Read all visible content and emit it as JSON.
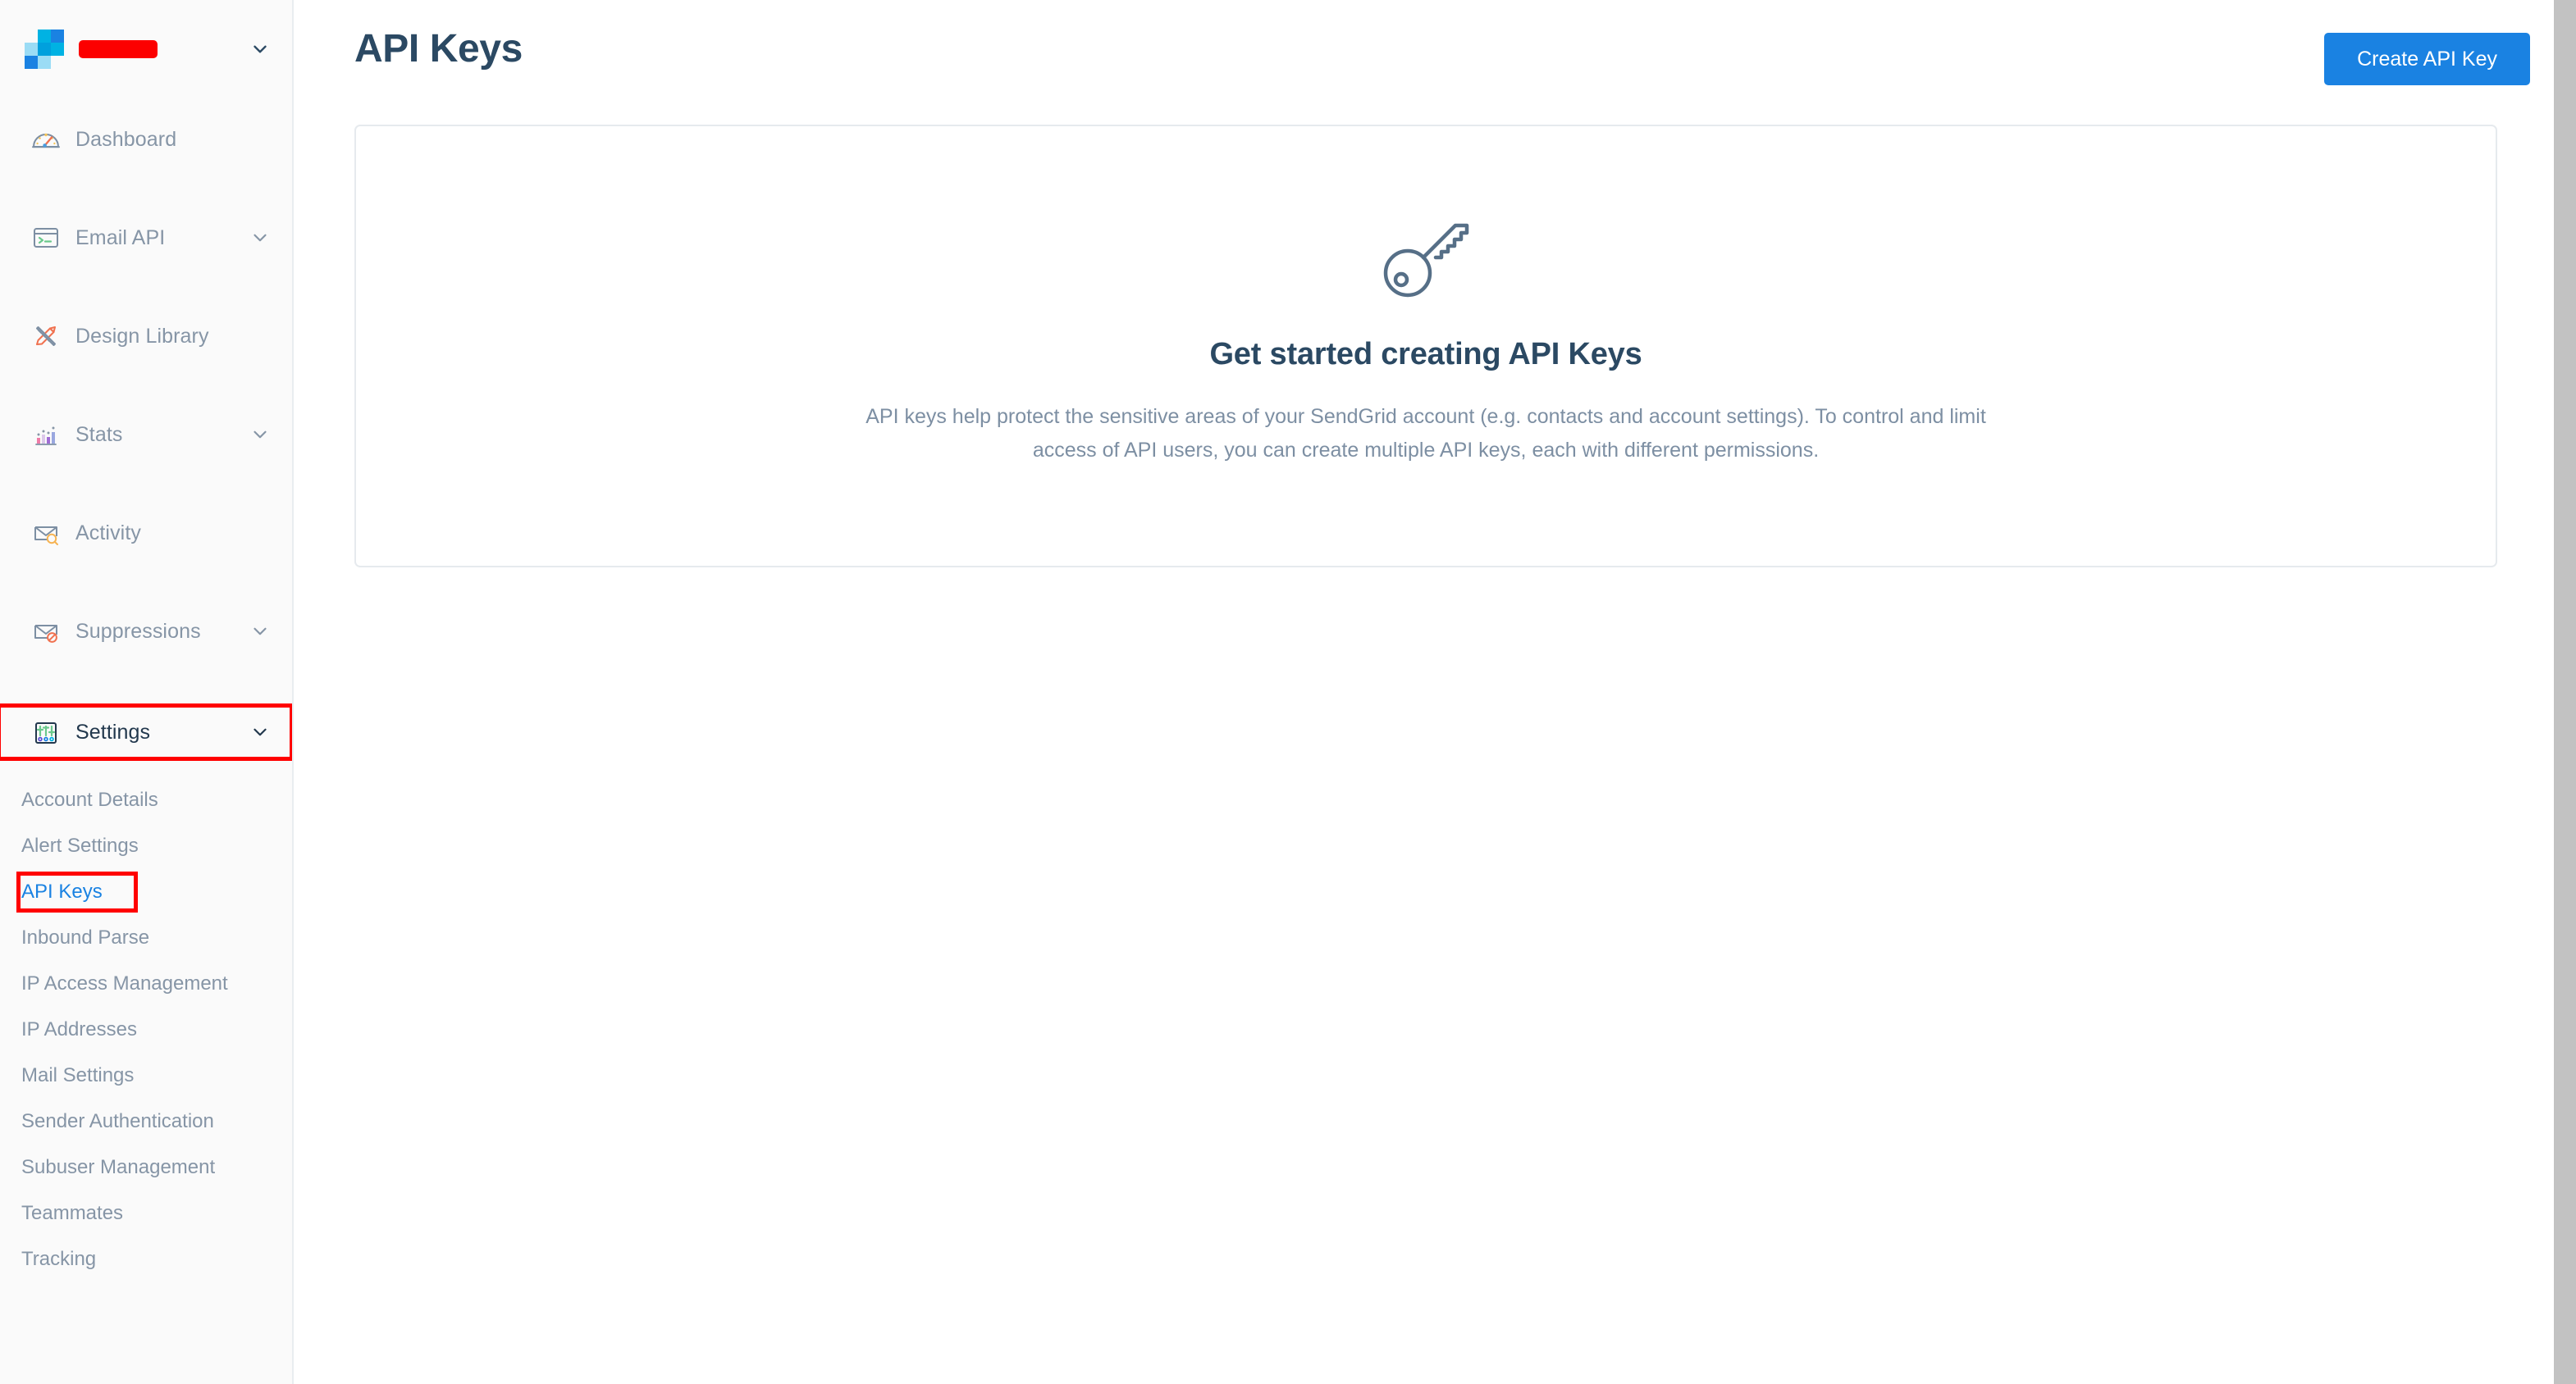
{
  "brand": {
    "logo_icon": "sendgrid-logo-icon",
    "account_name_redacted": "",
    "caret_icon": "chevron-down-icon",
    "logo_colors": [
      "#9bdcf5",
      "#00b2e3",
      "#1a82e2",
      "#1a82e2",
      "#9bdcf5",
      "#00b2e3",
      "#00a0dd",
      "#00b2e3",
      "#9bdcf5"
    ]
  },
  "sidebar": {
    "items": [
      {
        "label": "Dashboard",
        "icon": "gauge-icon",
        "has_caret": false,
        "active": false
      },
      {
        "label": "Email API",
        "icon": "terminal-icon",
        "has_caret": true,
        "active": false
      },
      {
        "label": "Design Library",
        "icon": "pencil-ruler-icon",
        "has_caret": false,
        "active": false
      },
      {
        "label": "Stats",
        "icon": "bar-chart-icon",
        "has_caret": true,
        "active": false
      },
      {
        "label": "Activity",
        "icon": "envelope-search-icon",
        "has_caret": false,
        "active": false
      },
      {
        "label": "Suppressions",
        "icon": "envelope-block-icon",
        "has_caret": true,
        "active": false
      },
      {
        "label": "Settings",
        "icon": "sliders-icon",
        "has_caret": true,
        "active": true
      }
    ],
    "sub_items": [
      {
        "label": "Account Details",
        "selected": false
      },
      {
        "label": "Alert Settings",
        "selected": false
      },
      {
        "label": "API Keys",
        "selected": true
      },
      {
        "label": "Inbound Parse",
        "selected": false
      },
      {
        "label": "IP Access Management",
        "selected": false
      },
      {
        "label": "IP Addresses",
        "selected": false
      },
      {
        "label": "Mail Settings",
        "selected": false
      },
      {
        "label": "Sender Authentication",
        "selected": false
      },
      {
        "label": "Subuser Management",
        "selected": false
      },
      {
        "label": "Teammates",
        "selected": false
      },
      {
        "label": "Tracking",
        "selected": false
      }
    ]
  },
  "header": {
    "title": "API Keys",
    "create_button_label": "Create API Key"
  },
  "empty_state": {
    "icon": "key-icon",
    "title": "Get started creating API Keys",
    "description": "API keys help protect the sensitive areas of your SendGrid account (e.g. contacts and account settings). To control and limit access of API users, you can create multiple API keys, each with different permissions."
  },
  "annotations": {
    "highlight_color": "#ff0000",
    "highlighted_elements": [
      "Settings",
      "API Keys"
    ]
  },
  "colors": {
    "accent_blue": "#1a82e2",
    "title_navy": "#2b4963",
    "muted_text": "#8695a6",
    "body_text": "#7d8fa3",
    "sidebar_bg": "#fafafa",
    "card_border": "#e6eaee"
  }
}
